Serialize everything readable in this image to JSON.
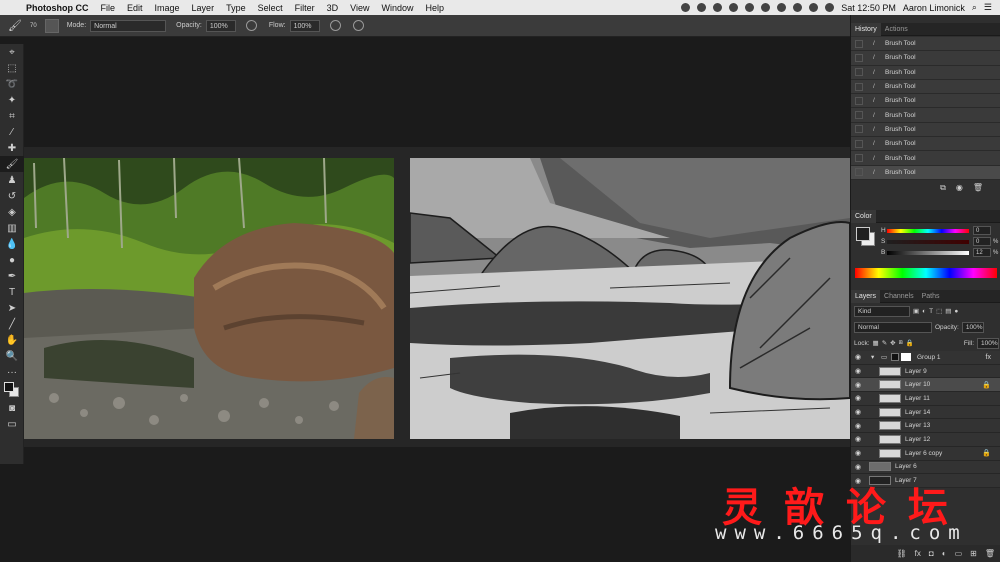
{
  "menubar": {
    "app_name": "Photoshop CC",
    "menus": [
      "File",
      "Edit",
      "Image",
      "Layer",
      "Type",
      "Select",
      "Filter",
      "3D",
      "View",
      "Window",
      "Help"
    ],
    "clock": "Sat 12:50 PM",
    "user": "Aaron Limonick"
  },
  "options": {
    "brush_size": "70",
    "mode_label": "Mode:",
    "mode_value": "Normal",
    "opacity_label": "Opacity:",
    "opacity_value": "100%",
    "flow_label": "Flow:",
    "flow_value": "100%"
  },
  "history": {
    "tabs": [
      "History",
      "Actions"
    ],
    "items": [
      "Brush Tool",
      "Brush Tool",
      "Brush Tool",
      "Brush Tool",
      "Brush Tool",
      "Brush Tool",
      "Brush Tool",
      "Brush Tool",
      "Brush Tool",
      "Brush Tool"
    ]
  },
  "color": {
    "tab": "Color",
    "rows": [
      {
        "label": "H",
        "value": "0",
        "unit": ""
      },
      {
        "label": "S",
        "value": "0",
        "unit": "%"
      },
      {
        "label": "B",
        "value": "12",
        "unit": "%"
      }
    ]
  },
  "layers": {
    "tabs": [
      "Layers",
      "Channels",
      "Paths"
    ],
    "filter_value": "Kind",
    "blend_value": "Normal",
    "opacity_label": "Opacity:",
    "opacity_value": "100%",
    "lock_label": "Lock:",
    "fill_label": "Fill:",
    "fill_value": "100%",
    "group_name": "Group 1",
    "items": [
      "Layer 9",
      "Layer 10",
      "Layer 11",
      "Layer 14",
      "Layer 13",
      "Layer 12",
      "Layer 6 copy",
      "Layer 6",
      "Layer 7"
    ]
  },
  "watermark": {
    "chinese": "灵歆论坛",
    "url": "www.6665q.com"
  },
  "colors": {
    "accent_red": "#ff1a1a",
    "panel_bg": "#2f2f2f"
  }
}
